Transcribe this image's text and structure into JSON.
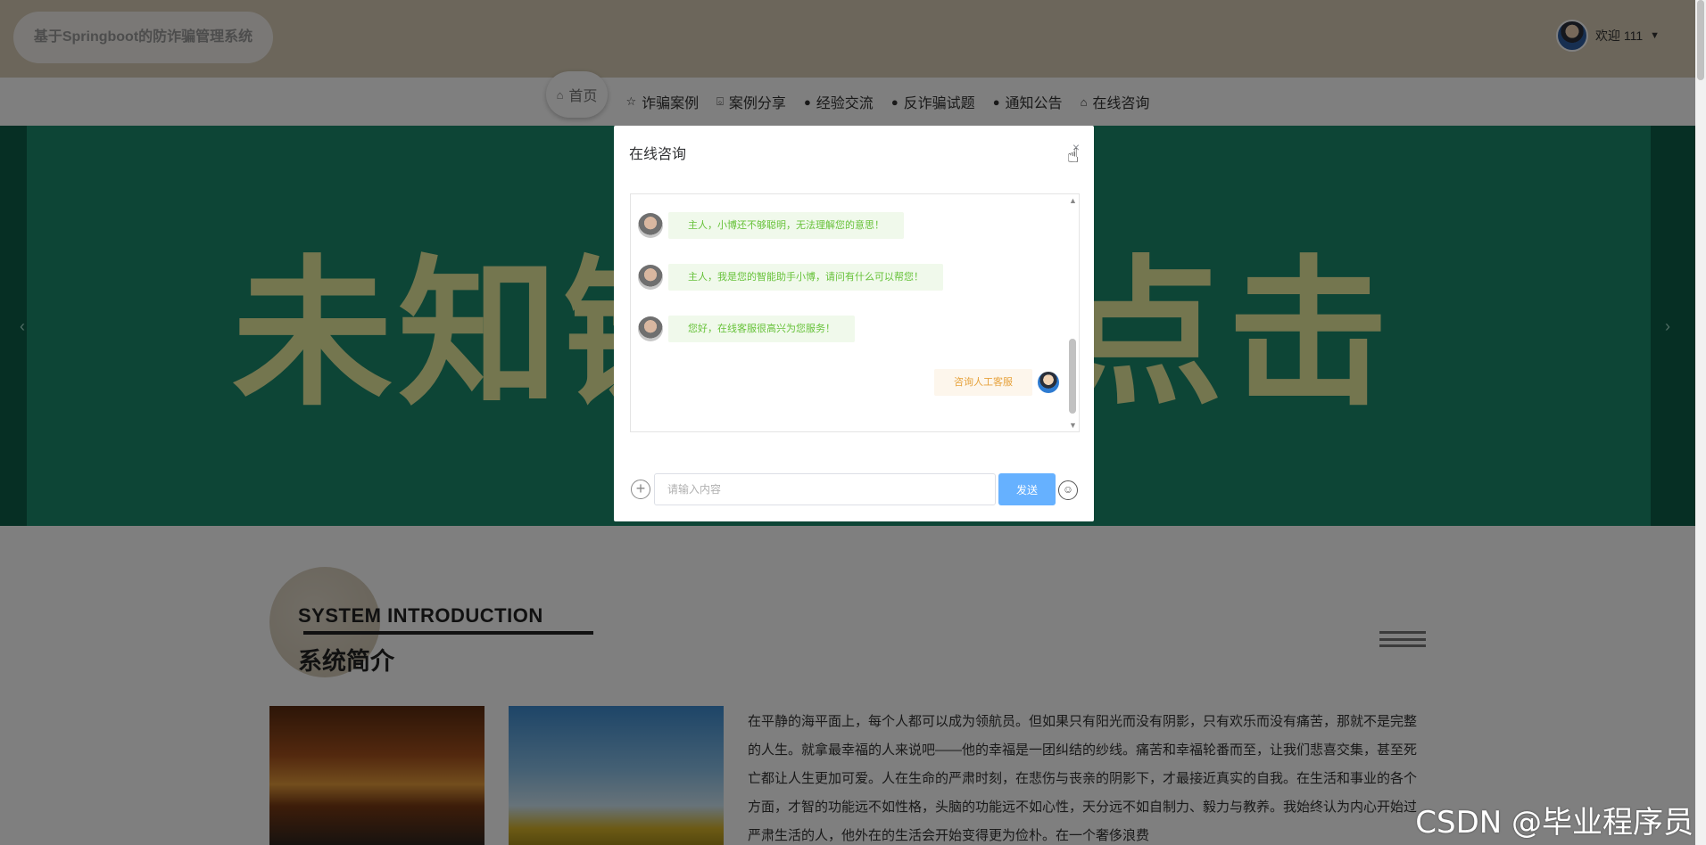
{
  "header": {
    "brand": "基于Springboot的防诈骗管理系统",
    "welcome": "欢迎 111",
    "caret": "▼"
  },
  "nav": {
    "items": [
      {
        "label": "首页",
        "icon": "⌂"
      },
      {
        "label": "诈骗案例",
        "icon": "☆"
      },
      {
        "label": "案例分享",
        "icon": "⌺"
      },
      {
        "label": "经验交流",
        "icon": "●"
      },
      {
        "label": "反诈骗试题",
        "icon": "●"
      },
      {
        "label": "通知公告",
        "icon": "●"
      },
      {
        "label": "在线咨询",
        "icon": "⌂"
      }
    ]
  },
  "banner": {
    "text": "未知链接不点击",
    "prev": "‹",
    "next": "›"
  },
  "intro": {
    "title_en": "SYSTEM INTRODUCTION",
    "title_cn": "系统简介",
    "text": "在平静的海平面上，每个人都可以成为领航员。但如果只有阳光而没有阴影，只有欢乐而没有痛苦，那就不是完整的人生。就拿最幸福的人来说吧——他的幸福是一团纠结的纱线。痛苦和幸福轮番而至，让我们悲喜交集，甚至死亡都让人生更加可爱。人在生命的严肃时刻，在悲伤与丧亲的阴影下，才最接近真实的自我。在生活和事业的各个方面，才智的功能远不如性格，头脑的功能远不如心性，天分远不如自制力、毅力与教养。我始终认为内心开始过严肃生活的人，他外在的生活会开始变得更为俭朴。在一个奢侈浪费"
  },
  "dialog": {
    "title": "在线咨询",
    "close": "×",
    "messages": [
      {
        "from": "bot",
        "text": "主人，小博还不够聪明，无法理解您的意思！"
      },
      {
        "from": "bot",
        "text": "主人，我是您的智能助手小博，请问有什么可以帮您！"
      },
      {
        "from": "bot",
        "text": "您好，在线客服很高兴为您服务！"
      },
      {
        "from": "user",
        "text": "咨询人工客服"
      }
    ],
    "input_placeholder": "请输入内容",
    "send_label": "发送",
    "plus": "+",
    "emoji": "☺"
  },
  "watermark": "CSDN @毕业程序员",
  "colors": {
    "header_bg": "#d8cdb6",
    "banner_bg": "#1b8a6c",
    "send_button": "#66b1ff",
    "bot_bubble": "#f0f9eb",
    "user_bubble": "#fdf6ec"
  }
}
